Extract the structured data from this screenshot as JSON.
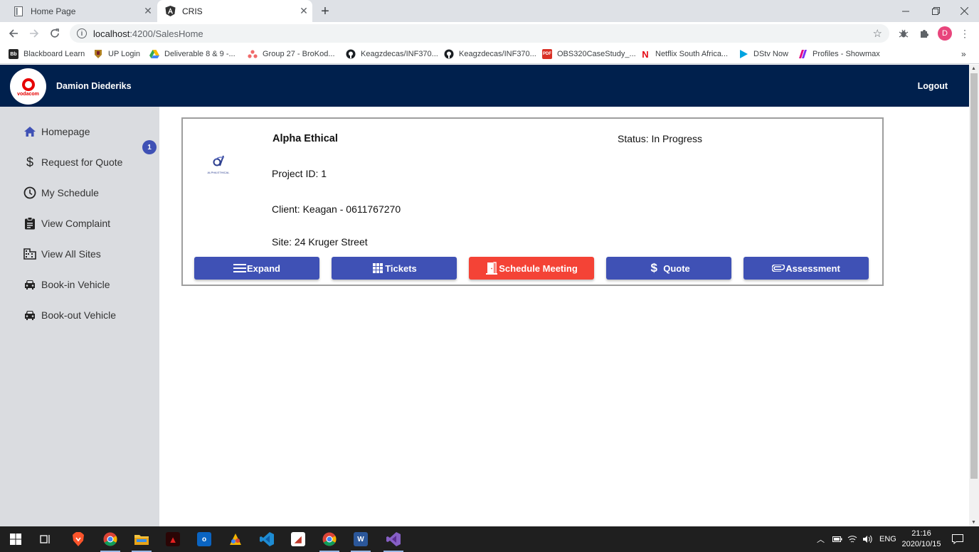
{
  "browser": {
    "tabs": [
      {
        "title": "Home Page",
        "active": false
      },
      {
        "title": "CRIS",
        "active": true
      }
    ],
    "url_host": "localhost",
    "url_rest": ":4200/SalesHome",
    "profile_initial": "D",
    "bookmarks": [
      "Blackboard Learn",
      "UP Login",
      "Deliverable 8 & 9 -...",
      "Group 27 - BroKod...",
      "Keagzdecas/INF370...",
      "Keagzdecas/INF370...",
      "OBS320CaseStudy_...",
      "Netflix South Africa...",
      "DStv Now",
      "Profiles - Showmax"
    ],
    "bookmark_icons": [
      "Bb",
      "",
      "",
      "",
      "",
      "",
      "PDF",
      "N",
      "",
      ""
    ]
  },
  "header": {
    "logo_text": "vodacom",
    "user_name": "Damion Diederiks",
    "logout_label": "Logout"
  },
  "sidebar": {
    "items": [
      {
        "label": "Homepage",
        "icon": "home-icon"
      },
      {
        "label": "Request for Quote",
        "icon": "dollar-icon"
      },
      {
        "label": "My Schedule",
        "icon": "clock-icon"
      },
      {
        "label": "View Complaint",
        "icon": "clipboard-icon"
      },
      {
        "label": "View All Sites",
        "icon": "building-icon"
      },
      {
        "label": "Book-in Vehicle",
        "icon": "car-icon"
      },
      {
        "label": "Book-out Vehicle",
        "icon": "car-icon"
      }
    ],
    "quote_badge": "1"
  },
  "project_card": {
    "company": "Alpha Ethical",
    "logo_caption": "ALPHA ETHICAL",
    "status": "Status: In Progress",
    "project_id": "Project ID: 1",
    "client": "Client: Keagan - 0611767270",
    "site": "Site: 24 Kruger Street",
    "buttons": {
      "expand": "Expand",
      "tickets": "Tickets",
      "schedule_meeting": "Schedule Meeting",
      "quote": "Quote",
      "assessment": "Assessment"
    }
  },
  "taskbar": {
    "language": "ENG",
    "time": "21:16",
    "date": "2020/10/15"
  },
  "colors": {
    "header_bg": "#00204d",
    "sidebar_bg": "#dadce0",
    "primary": "#3f51b5",
    "warn": "#f44336",
    "brand_red": "#e60000"
  }
}
